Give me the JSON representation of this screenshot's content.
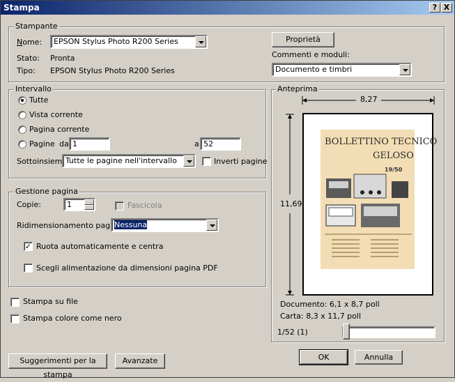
{
  "window": {
    "title": "Stampa",
    "help_btn": "?",
    "close_btn": "X"
  },
  "printer": {
    "group_label": "Stampante",
    "name_label": "Nome:",
    "name_value": "EPSON Stylus Photo R200 Series",
    "status_label": "Stato:",
    "status_value": "Pronta",
    "type_label": "Tipo:",
    "type_value": "EPSON Stylus Photo R200 Series",
    "properties_btn": "Proprietà",
    "comments_label": "Commenti e moduli:",
    "comments_value": "Documento e  timbri"
  },
  "range": {
    "group_label": "Intervallo",
    "all": "Tutte",
    "current_view": "Vista corrente",
    "current_page": "Pagina corrente",
    "pages": "Pagine",
    "from_label": "da:",
    "from_value": "1",
    "to_label": "a:",
    "to_value": "52",
    "subset_label": "Sottoinsieme:",
    "subset_value": "Tutte le pagine nell'intervallo",
    "reverse_label": "Inverti pagine"
  },
  "handling": {
    "group_label": "Gestione pagina",
    "copies_label": "Copie:",
    "copies_value": "1",
    "collate_label": "Fascicola",
    "scaling_label": "Ridimensionamento pagina:",
    "scaling_value": "Nessuna",
    "autorotate_label": "Ruota automaticamente e centra",
    "pdf_source_label": "Scegli alimentazione da dimensioni pagina PDF"
  },
  "options": {
    "print_to_file": "Stampa su file",
    "color_as_black": "Stampa colore come nero"
  },
  "preview": {
    "group_label": "Anteprima",
    "width": "8,27",
    "height": "11,69",
    "doc_title_1": "BOLLETTINO TECNICO",
    "doc_title_2": "GELOSO",
    "doc_issue": "19/50",
    "document_info": "Documento: 6,1 x 8,7 poll",
    "paper_info": "Carta: 8,3 x 11,7 poll",
    "page_counter": "1/52 (1)"
  },
  "footer": {
    "tips_btn": "Suggerimenti per la stampa",
    "advanced_btn": "Avanzate",
    "ok_btn": "OK",
    "cancel_btn": "Annulla"
  }
}
